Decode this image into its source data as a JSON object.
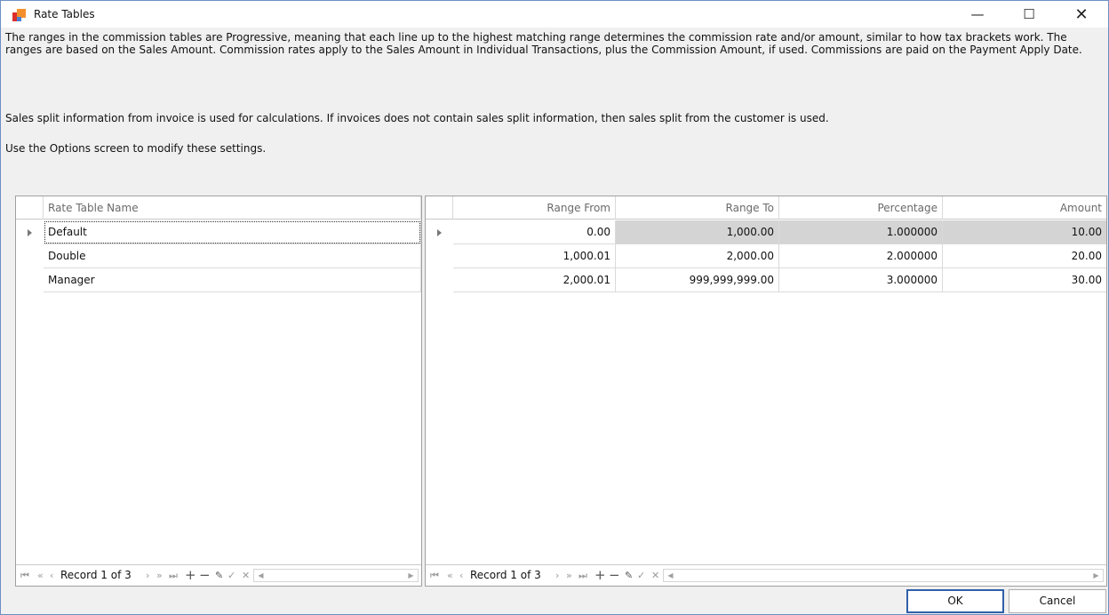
{
  "window": {
    "title": "Rate Tables",
    "minimize_glyph": "—",
    "maximize_glyph": "☐",
    "close_glyph": "✕"
  },
  "info": {
    "line1": "The ranges in the commission tables are Progressive, meaning that each line up to the highest matching range determines the commission rate and/or amount, similar to how tax brackets work. The ranges are based on the Sales Amount. Commission rates apply to the Sales Amount in Individual Transactions, plus the Commission Amount, if used. Commissions are paid on the Payment Apply Date.",
    "line2": "Sales split information from invoice is used for calculations. If invoices does not contain sales split information, then sales split from the customer is used.",
    "line3": "Use the Options screen to modify these settings."
  },
  "left_grid": {
    "header": "Rate Table Name",
    "rows": [
      "Default",
      "Double",
      "Manager"
    ],
    "navigator": {
      "record_text": "Record 1 of 3"
    }
  },
  "right_grid": {
    "headers": [
      "Range From",
      "Range To",
      "Percentage",
      "Amount"
    ],
    "rows": [
      [
        "0.00",
        "1,000.00",
        "1.000000",
        "10.00"
      ],
      [
        "1,000.01",
        "2,000.00",
        "2.000000",
        "20.00"
      ],
      [
        "2,000.01",
        "999,999,999.00",
        "3.000000",
        "30.00"
      ]
    ],
    "navigator": {
      "record_text": "Record 1 of 3"
    }
  },
  "navigator_glyphs": {
    "first": "⏮",
    "prev_page": "«",
    "prev": "‹",
    "next": "›",
    "next_page": "»",
    "last": "⏭",
    "add": "+",
    "remove": "−",
    "edit": "✎",
    "end_edit": "✓",
    "cancel_edit": "✕"
  },
  "buttons": {
    "ok": "OK",
    "cancel": "Cancel"
  }
}
